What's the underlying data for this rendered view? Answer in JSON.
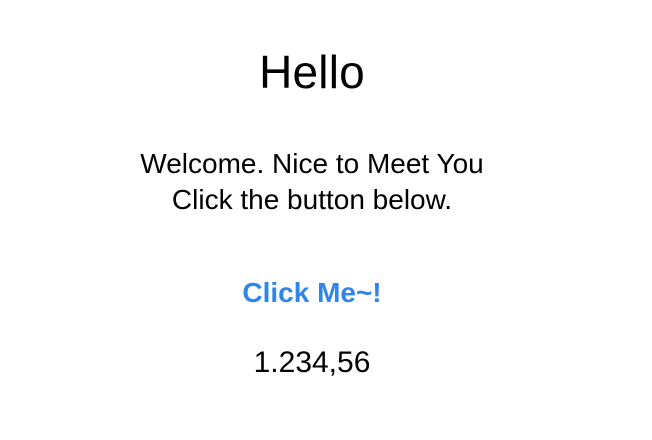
{
  "screen": {
    "title": "Hello",
    "message_lines": [
      "Welcome. Nice to Meet You",
      "Click the button below."
    ],
    "button_label": "Click Me~!",
    "value_text": "1.234,56",
    "colors": {
      "background": "#ffffff",
      "text": "#000000",
      "button_text": "#2f86e8"
    }
  }
}
